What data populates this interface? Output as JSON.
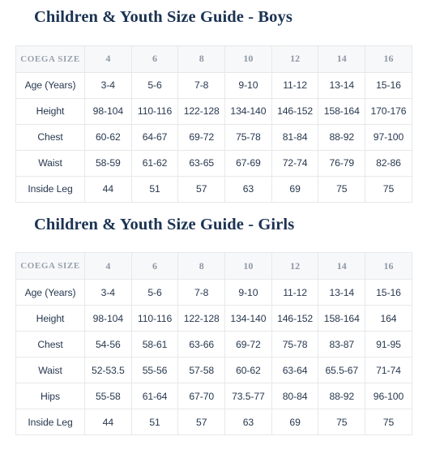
{
  "guides": [
    {
      "id": "boys",
      "title": "Children & Youth Size Guide - Boys",
      "table": {
        "header": {
          "label": "COEGA SIZE",
          "sizes": [
            "4",
            "6",
            "8",
            "10",
            "12",
            "14",
            "16"
          ]
        },
        "rows": [
          {
            "label": "Age (Years)",
            "values": [
              "3-4",
              "5-6",
              "7-8",
              "9-10",
              "11-12",
              "13-14",
              "15-16"
            ]
          },
          {
            "label": "Height",
            "values": [
              "98-104",
              "110-116",
              "122-128",
              "134-140",
              "146-152",
              "158-164",
              "170-176"
            ]
          },
          {
            "label": "Chest",
            "values": [
              "60-62",
              "64-67",
              "69-72",
              "75-78",
              "81-84",
              "88-92",
              "97-100"
            ]
          },
          {
            "label": "Waist",
            "values": [
              "58-59",
              "61-62",
              "63-65",
              "67-69",
              "72-74",
              "76-79",
              "82-86"
            ]
          },
          {
            "label": "Inside Leg",
            "values": [
              "44",
              "51",
              "57",
              "63",
              "69",
              "75",
              "75"
            ]
          }
        ]
      }
    },
    {
      "id": "girls",
      "title": "Children & Youth Size Guide - Girls",
      "table": {
        "header": {
          "label": "COEGA SIZE",
          "sizes": [
            "4",
            "6",
            "8",
            "10",
            "12",
            "14",
            "16"
          ]
        },
        "rows": [
          {
            "label": "Age (Years)",
            "values": [
              "3-4",
              "5-6",
              "7-8",
              "9-10",
              "11-12",
              "13-14",
              "15-16"
            ]
          },
          {
            "label": "Height",
            "values": [
              "98-104",
              "110-116",
              "122-128",
              "134-140",
              "146-152",
              "158-164",
              "164"
            ]
          },
          {
            "label": "Chest",
            "values": [
              "54-56",
              "58-61",
              "63-66",
              "69-72",
              "75-78",
              "83-87",
              "91-95"
            ]
          },
          {
            "label": "Waist",
            "values": [
              "52-53.5",
              "55-56",
              "57-58",
              "60-62",
              "63-64",
              "65.5-67",
              "71-74"
            ]
          },
          {
            "label": "Hips",
            "values": [
              "55-58",
              "61-64",
              "67-70",
              "73.5-77",
              "80-84",
              "88-92",
              "96-100"
            ]
          },
          {
            "label": "Inside Leg",
            "values": [
              "44",
              "51",
              "57",
              "63",
              "69",
              "75",
              "75"
            ]
          }
        ]
      }
    }
  ],
  "colors": {
    "title": "#1c3353",
    "header_bg": "#f7f8f9",
    "header_text": "#98a1ae",
    "body_text": "#27384f",
    "border": "#e6e8ea",
    "page_bg": "#ffffff"
  }
}
